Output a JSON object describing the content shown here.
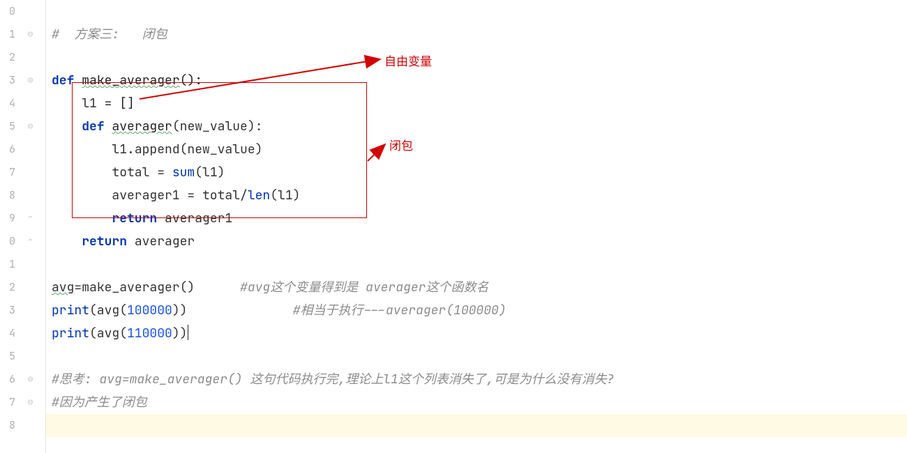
{
  "annotations": {
    "free_var": "自由变量",
    "closure": "闭包"
  },
  "gutter": {
    "start": 0,
    "lines": [
      "0",
      "1",
      "2",
      "3",
      "4",
      "5",
      "6",
      "7",
      "8",
      "9",
      "0",
      "1",
      "2",
      "3",
      "4",
      "5",
      "6",
      "7",
      "8"
    ]
  },
  "code": {
    "l0_comment": "#  方案三:   闭包",
    "l2_def": "def",
    "l2_name": "make_averager",
    "l2_paren": "():",
    "l3_var": "l1",
    "l3_eq": " = []",
    "l4_def": "def",
    "l4_name": "averager",
    "l4_param": "new_value",
    "l5_call_obj": "l1",
    "l5_call": ".append(new_value)",
    "l6_lhs": "total",
    "l6_eq": " = ",
    "l6_sum": "sum",
    "l6_arg": "(l1)",
    "l7_lhs": "averager1",
    "l7_eq": " = total/",
    "l7_len": "len",
    "l7_arg": "(l1)",
    "l8_ret": "return",
    "l8_val": " averager1",
    "l9_ret": "return",
    "l9_val": " averager",
    "l11_lhs": "avg",
    "l11_eq": "=",
    "l11_call": "make_averager()",
    "l11_cmt": "#avg这个变量得到是 averager这个函数名",
    "l12_print": "print",
    "l12_open": "(avg(",
    "l12_num": "100000",
    "l12_close": "))",
    "l12_cmt": "#相当于执行---averager(100000)",
    "l13_print": "print",
    "l13_open": "(avg(",
    "l13_num": "110000",
    "l13_close": "))",
    "l15_cmt": "#思考: avg=make_averager() 这句代码执行完,理论上l1这个列表消失了,可是为什么没有消失?",
    "l16_cmt": "#因为产生了闭包"
  }
}
